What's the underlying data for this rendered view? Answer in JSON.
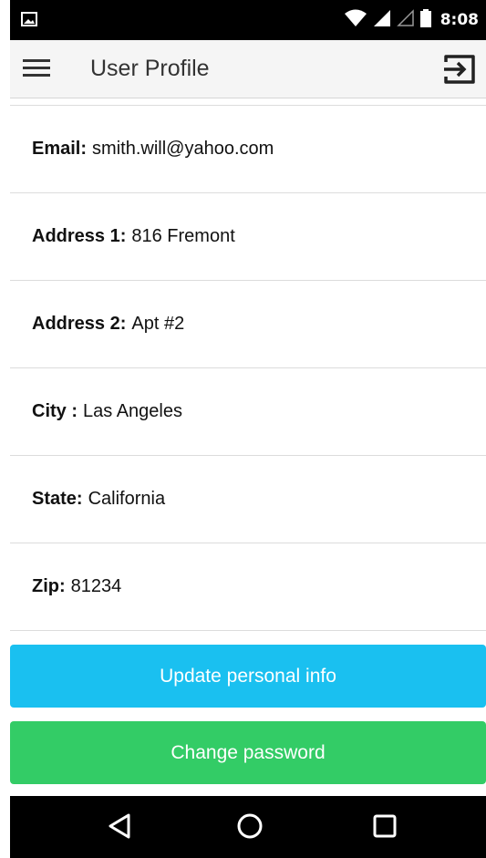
{
  "status_bar": {
    "time": "8:08",
    "icons": [
      "image-icon",
      "wifi-icon",
      "signal-icon",
      "signal-empty-icon",
      "battery-icon"
    ]
  },
  "app_bar": {
    "title": "User Profile",
    "menu_icon": "menu-icon",
    "action_icon": "logout-icon"
  },
  "profile": {
    "rows": [
      {
        "label": "Email:",
        "value": "smith.will@yahoo.com"
      },
      {
        "label": "Address 1:",
        "value": "816 Fremont"
      },
      {
        "label": "Address 2:",
        "value": "Apt #2"
      },
      {
        "label": "City :",
        "value": "Las Angeles"
      },
      {
        "label": "State:",
        "value": "California"
      },
      {
        "label": "Zip:",
        "value": "81234"
      }
    ]
  },
  "buttons": {
    "update_label": "Update personal info",
    "password_label": "Change password"
  },
  "colors": {
    "update_button": "#1ac0f0",
    "password_button": "#33cc66",
    "appbar": "#f5f5f5"
  },
  "nav_bar": {
    "icons": [
      "back-icon",
      "home-icon",
      "recents-icon"
    ]
  }
}
